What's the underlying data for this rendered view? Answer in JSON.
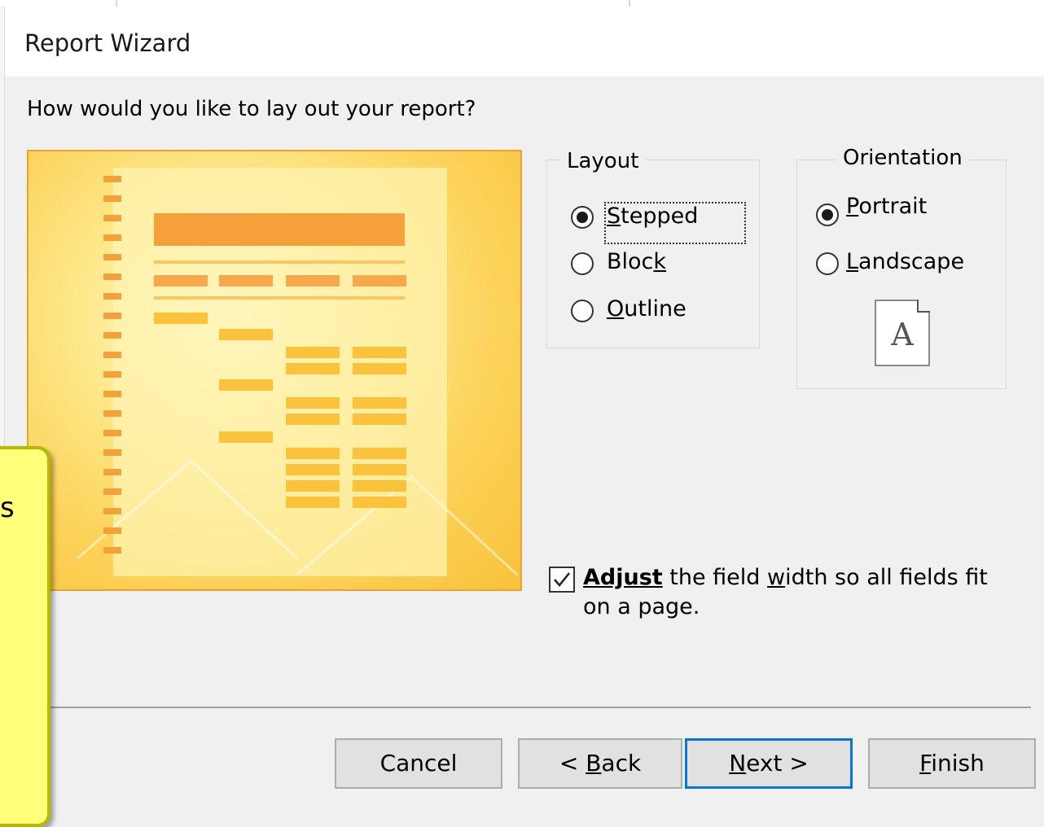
{
  "window": {
    "title": "Report Wizard"
  },
  "question": "How would you like to lay out your report?",
  "layout_group": {
    "legend": "Layout",
    "options": [
      {
        "label": "Stepped",
        "checked": true
      },
      {
        "label": "Block",
        "checked": false
      },
      {
        "label": "Outline",
        "checked": false
      }
    ]
  },
  "orientation_group": {
    "legend": "Orientation",
    "options": [
      {
        "label": "Portrait",
        "checked": true
      },
      {
        "label": "Landscape",
        "checked": false
      }
    ],
    "icon_letter": "A"
  },
  "adjust_width": {
    "checked": true,
    "bold_word": "Adjust",
    "rest_text": " the field width so all fields fit on a page."
  },
  "buttons": {
    "cancel": "Cancel",
    "back": "< Back",
    "next": "Next >",
    "finish": "Finish"
  },
  "callout": {
    "visible_text": "s"
  },
  "colors": {
    "preview_border": "#f0a030",
    "default_button_border": "#0078d7",
    "callout_fill": "#ffff7a"
  }
}
